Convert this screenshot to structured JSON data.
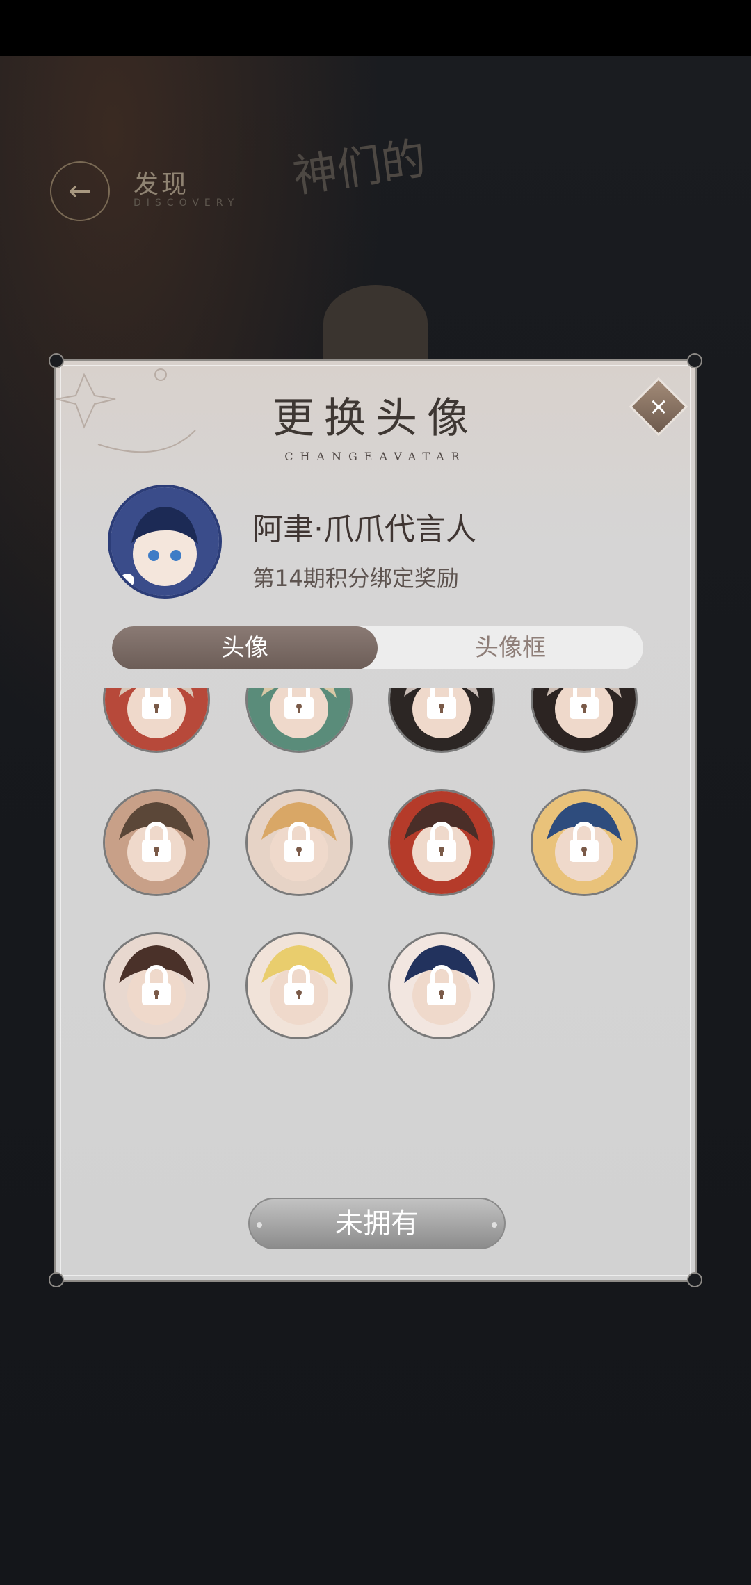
{
  "background": {
    "nav_title": "发现",
    "nav_subtitle": "DISCOVERY",
    "logo_text": "神们的"
  },
  "modal": {
    "title": "更换头像",
    "subtitle": "CHANGEAVATAR",
    "close_label": "×",
    "current": {
      "name": "阿聿·爪爪代言人",
      "description": "第14期积分绑定奖励"
    },
    "tabs": [
      {
        "label": "头像",
        "active": true
      },
      {
        "label": "头像框",
        "active": false
      }
    ],
    "avatars": [
      {
        "icon": "avatar-red-hair",
        "locked": true,
        "colors": [
          "#d8c4b4",
          "#b7493a"
        ]
      },
      {
        "icon": "avatar-teal",
        "locked": true,
        "colors": [
          "#d9c8a6",
          "#5a8c7a"
        ]
      },
      {
        "icon": "avatar-dark-hair",
        "locked": true,
        "colors": [
          "#c9bcb6",
          "#2c2624"
        ]
      },
      {
        "icon": "avatar-dark-long",
        "locked": true,
        "colors": [
          "#cabab0",
          "#2c2422"
        ]
      },
      {
        "icon": "avatar-brown-long",
        "locked": true,
        "colors": [
          "#5b4738",
          "#c8a088"
        ]
      },
      {
        "icon": "avatar-blond",
        "locked": true,
        "colors": [
          "#d9a766",
          "#e6d3c6"
        ]
      },
      {
        "icon": "avatar-chibi-brown",
        "locked": true,
        "colors": [
          "#4a2e28",
          "#b53b2a"
        ]
      },
      {
        "icon": "avatar-chibi-blue",
        "locked": true,
        "colors": [
          "#2e4c7d",
          "#e9c27a"
        ]
      },
      {
        "icon": "avatar-chibi-bunny",
        "locked": true,
        "colors": [
          "#4a3129",
          "#e8d8cf"
        ]
      },
      {
        "icon": "avatar-chibi-yellow",
        "locked": true,
        "colors": [
          "#e9cd6d",
          "#f1e3d9"
        ]
      },
      {
        "icon": "avatar-chibi-navy",
        "locked": true,
        "colors": [
          "#22325d",
          "#f2e6e0"
        ]
      }
    ],
    "own_button_label": "未拥有"
  },
  "colors": {
    "modal_bg": "#d4d4d4",
    "tab_active": "#7a6a64",
    "accent": "#8a7a74"
  }
}
